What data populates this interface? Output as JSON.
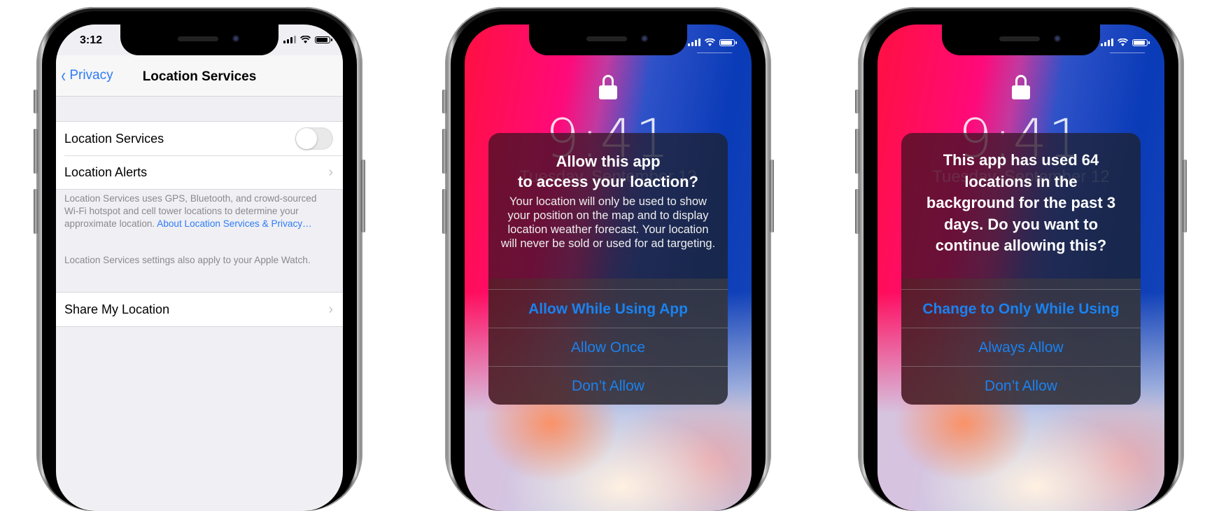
{
  "screens": {
    "settings": {
      "status_time": "3:12",
      "nav": {
        "back_label": "Privacy",
        "title": "Location Services"
      },
      "rows": {
        "location_services": {
          "label": "Location Services",
          "toggle_on": false
        },
        "location_alerts": {
          "label": "Location Alerts"
        },
        "share_my_location": {
          "label": "Share My Location"
        }
      },
      "footnote1": {
        "text": "Location Services uses GPS, Bluetooth, and crowd-sourced Wi-Fi hotspot and cell tower locations to determine your approximate location. ",
        "link": "About Location Services & Privacy…"
      },
      "footnote2": "Location Services settings also apply to your Apple Watch.",
      "colors": {
        "accent": "#2f7cf6",
        "background": "#efeff4"
      }
    },
    "permission_prompt": {
      "lock_time": "9:41",
      "lock_date": "Tuesday, September 12",
      "alert": {
        "title": "Allow this app\nto access your loaction?",
        "message": "Your location will only be used to show your position on the map and to display location weather forecast. Your location will never be sold or used for ad targeting.",
        "buttons": [
          "Allow While Using App",
          "Allow Once",
          "Don’t Allow"
        ]
      }
    },
    "background_reminder": {
      "lock_time": "9:41",
      "lock_date": "Tuesday, September 12",
      "alert": {
        "title": "This app has used 64 locations in the background for the past 3 days. Do you want to continue allowing this?",
        "buttons": [
          "Change to Only While Using",
          "Always Allow",
          "Don’t Allow"
        ]
      }
    }
  },
  "colors": {
    "button_blue": "#1a82f0"
  },
  "icons": {
    "back": "chevron-left-icon",
    "disclosure": "chevron-right-icon",
    "lock": "lock-icon",
    "signal": "signal-icon",
    "wifi": "wifi-icon",
    "battery": "battery-icon"
  }
}
